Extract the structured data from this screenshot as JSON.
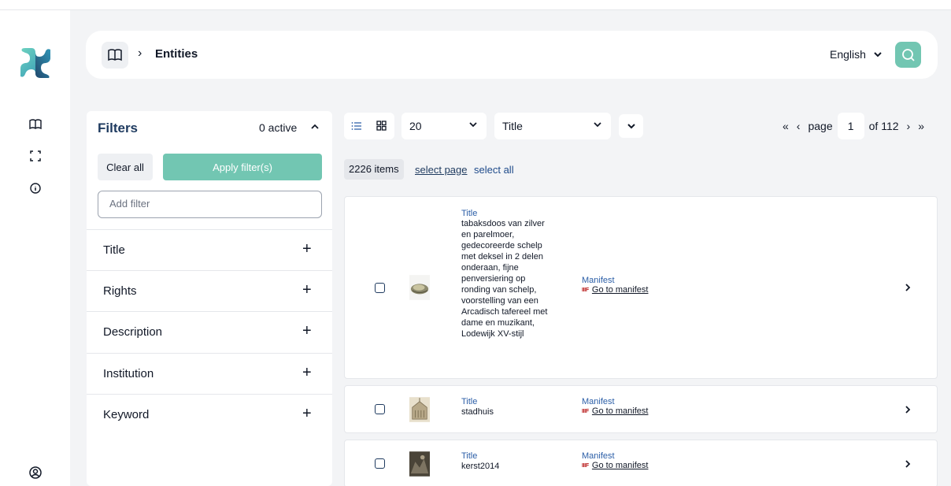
{
  "sidebar": {
    "logo": "app-logo",
    "icons": [
      "book-icon",
      "fullscreen-icon",
      "info-icon",
      "user-icon"
    ]
  },
  "header": {
    "breadcrumb_separator": "›",
    "title": "Entities",
    "language": "English"
  },
  "filters": {
    "title": "Filters",
    "active_count": "0 active",
    "clear_label": "Clear all",
    "apply_label": "Apply filter(s)",
    "add_placeholder": "Add filter",
    "facets": [
      {
        "label": "Title"
      },
      {
        "label": "Rights"
      },
      {
        "label": "Description"
      },
      {
        "label": "Institution"
      },
      {
        "label": "Keyword"
      }
    ]
  },
  "toolbar": {
    "page_size": "20",
    "sort_field": "Title",
    "page_label": "page",
    "page_number": "1",
    "of_label": "of 112",
    "first": "«",
    "prev": "‹",
    "next": "›",
    "last": "»"
  },
  "selection": {
    "items_count": "2226 items",
    "select_page": "select page",
    "select_all": "select all"
  },
  "results": [
    {
      "title_label": "Title",
      "title": "tabaksdoos van zilver en parelmoer, gedecoreerde schelp met deksel in 2 delen onderaan, fijne penversiering op ronding van schelp, voorstelling van een Arcadisch tafereel met dame en muzikant, Lodewijk XV-stijl",
      "manifest_label": "Manifest",
      "iiif": "IIIF",
      "manifest_link": "Go to manifest"
    },
    {
      "title_label": "Title",
      "title": "stadhuis",
      "manifest_label": "Manifest",
      "iiif": "IIIF",
      "manifest_link": "Go to manifest"
    },
    {
      "title_label": "Title",
      "title": "kerst2014",
      "manifest_label": "Manifest",
      "iiif": "IIIF",
      "manifest_link": "Go to manifest"
    }
  ],
  "colors": {
    "accent": "#72c6b2",
    "navy": "#1e3a5f",
    "background": "#f3f4f6"
  }
}
